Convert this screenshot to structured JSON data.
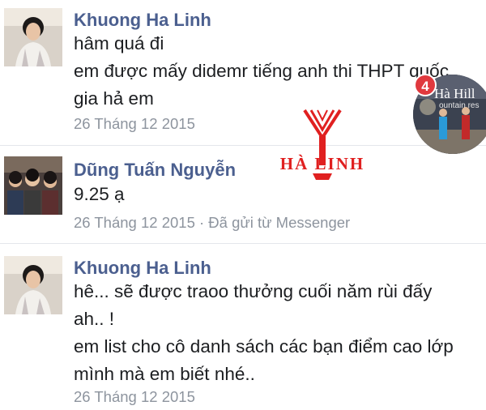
{
  "messages": [
    {
      "author": "Khuong Ha Linh",
      "lines": [
        "hâm quá đi",
        "em được mấy didemr tiếng anh thi THPT quốc",
        "gia hả em"
      ],
      "meta": "26 Tháng 12 2015"
    },
    {
      "author": "Dũng Tuấn Nguyễn",
      "lines": [
        "9.25 ạ"
      ],
      "meta": "26 Tháng 12 2015 · Đã gửi từ Messenger"
    },
    {
      "author": "Khuong Ha Linh",
      "lines": [
        "hê... sẽ được traoo thưởng cuối năm rùi đấy",
        "ah.. !",
        "em list cho cô danh sách các bạn điểm cao lớp",
        "mình mà em biết nhé.."
      ],
      "meta": "26 Tháng 12 2015"
    }
  ],
  "chat_head": {
    "badge_count": "4",
    "sign_text": "Hà Hill",
    "sign_subtext": "ountain res"
  },
  "watermark": {
    "text": "HÀ LINH",
    "color": "#e02020"
  },
  "colors": {
    "author_name": "#4b5f8f",
    "meta_text": "#8d949e",
    "badge": "#e0393e"
  },
  "icons": {
    "avatar_1": "woman-portrait",
    "avatar_2": "group-photo",
    "avatar_3": "woman-portrait",
    "logo": "ha-linh-logo"
  }
}
